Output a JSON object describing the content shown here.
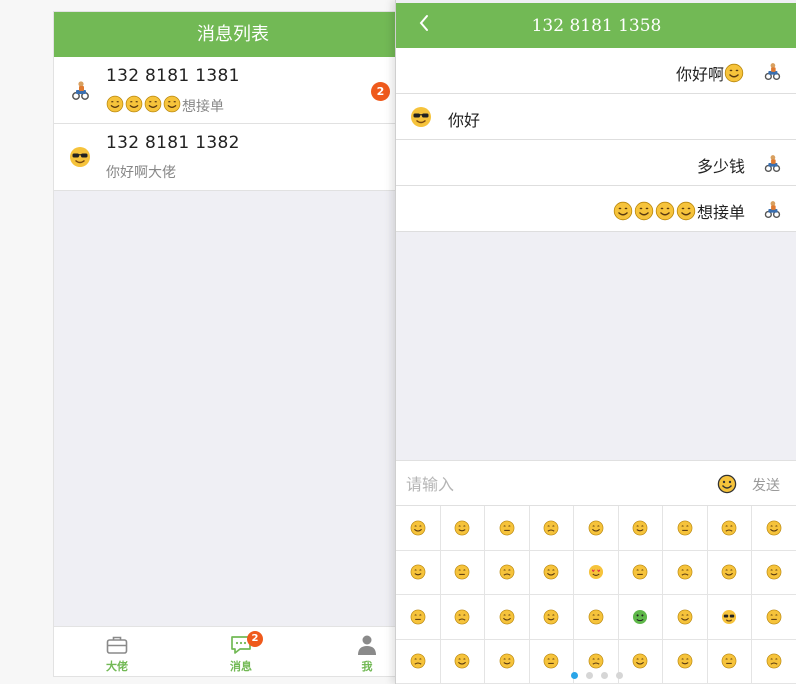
{
  "list_screen": {
    "title": "消息列表",
    "conversations": [
      {
        "name": "132 8181 1381",
        "preview": "想接单",
        "preview_emoji_count": 4,
        "unread": "2",
        "avatar": "rider-avatar-icon"
      },
      {
        "name": "132 8181 1382",
        "preview": "你好啊大佬",
        "avatar": "sunglasses-emoji-icon"
      }
    ],
    "tabs": [
      {
        "label": "大佬",
        "icon": "briefcase-icon"
      },
      {
        "label": "消息",
        "icon": "chat-bubble-icon",
        "badge": "2"
      },
      {
        "label": "我",
        "icon": "person-icon"
      }
    ]
  },
  "chat_screen": {
    "title": "132 8181 1358",
    "back_icon": "chevron-left-icon",
    "messages": [
      {
        "side": "right",
        "text": "你好啊",
        "trailing_emoji": true
      },
      {
        "side": "left",
        "text": "你好"
      },
      {
        "side": "right",
        "text": "多少钱"
      },
      {
        "side": "right",
        "text": "想接单",
        "leading_emoji_count": 4
      }
    ],
    "input": {
      "placeholder": "请输入",
      "value": ""
    },
    "send_label": "发送",
    "emoji_page_count": 4,
    "emoji_page_active": 1
  },
  "colors": {
    "brand_green": "#72b955",
    "badge_orange": "#ef5a1c",
    "emoji_yellow": "#f6c33b",
    "page_dot_blue": "#2aa5e8"
  }
}
